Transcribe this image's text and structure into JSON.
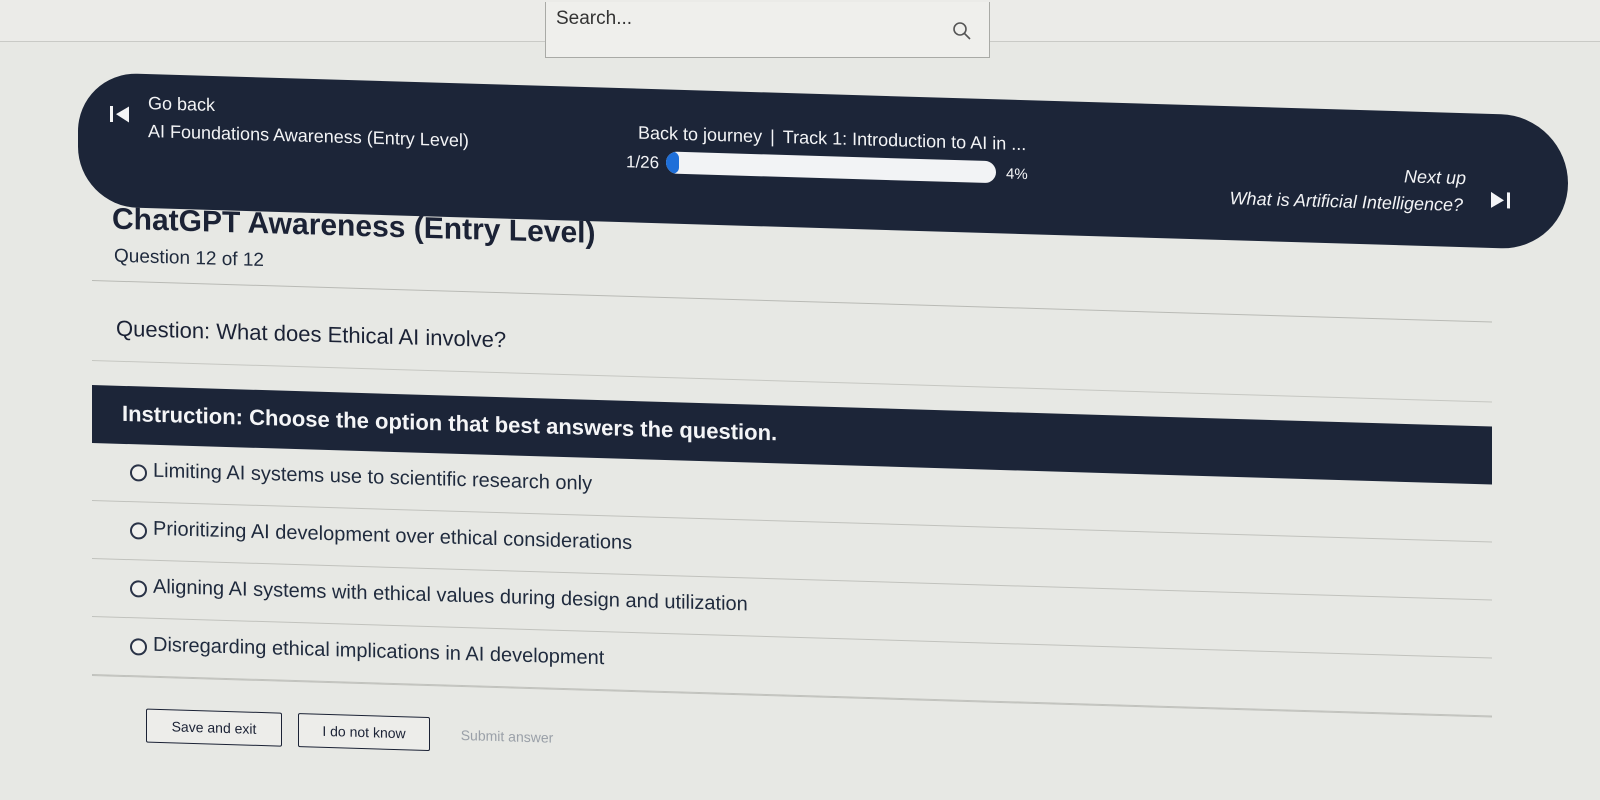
{
  "search": {
    "placeholder": "Search..."
  },
  "banner": {
    "go_back": "Go back",
    "course_title": "AI Foundations Awareness (Entry Level)",
    "back_to_journey": "Back to journey",
    "separator": "|",
    "track": "Track 1: Introduction to AI in ...",
    "position": "1/26",
    "progress_percent": 4,
    "progress_label": "4%",
    "next_up_label": "Next up",
    "next_title": "What is Artificial Intelligence?"
  },
  "quiz": {
    "title": "ChatGPT Awareness (Entry Level)",
    "question_count": "Question 12 of 12",
    "question_label": "Question:",
    "question_text": "What does Ethical AI involve?",
    "instruction": "Instruction: Choose the option that best answers the question.",
    "options": [
      {
        "label": "Limiting AI systems use to scientific research only",
        "selected": false
      },
      {
        "label": "Prioritizing AI development over ethical considerations",
        "selected": false
      },
      {
        "label": "Aligning AI systems with ethical values during design and utilization",
        "selected": false
      },
      {
        "label": "Disregarding ethical implications in AI development",
        "selected": false
      }
    ]
  },
  "actions": {
    "save_exit": "Save and exit",
    "dont_know": "I do not know",
    "submit": "Submit answer"
  },
  "colors": {
    "banner_bg": "#1c2538",
    "progress_fill": "#1e6fd9",
    "page_bg": "#e7e8e4"
  }
}
